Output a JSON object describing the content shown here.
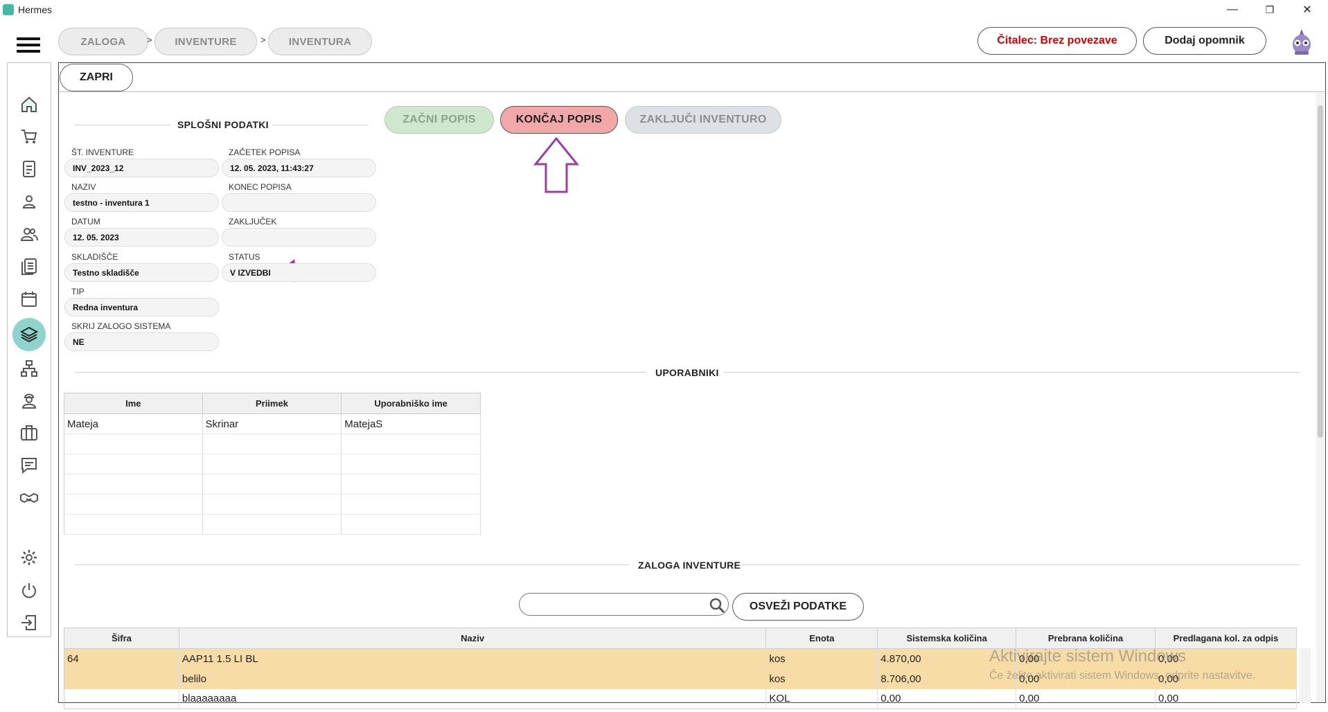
{
  "window": {
    "title": "Hermes",
    "minimize": "—",
    "maximize": "❐",
    "close": "✕"
  },
  "breadcrumb": [
    "ZALOGA",
    "INVENTURE",
    "INVENTURA"
  ],
  "breadcrumb_sep": ">",
  "header": {
    "reader_status": "Čitalec: Brez povezave",
    "reader_color": "#d00000",
    "add_reminder": "Dodaj opomnik"
  },
  "toolbar": {
    "close": "ZAPRI"
  },
  "actions": {
    "start": "ZAČNI POPIS",
    "start_color": "#cfe6cf",
    "finish": "KONČAJ POPIS",
    "finish_color": "#f2a7a9",
    "close_inventory": "ZAKLJUČI INVENTURO",
    "close_color": "#dde0e4"
  },
  "general": {
    "title": "SPLOŠNI PODATKI",
    "inv_no_label": "ŠT. INVENTURE",
    "inv_no": "INV_2023_12",
    "name_label": "NAZIV",
    "name": "testno - inventura 1",
    "date_label": "DATUM",
    "date": "12. 05. 2023",
    "warehouse_label": "SKLADIŠČE",
    "warehouse": "Testno skladišče",
    "type_label": "TIP",
    "type": "Redna inventura",
    "hide_label": "SKRIJ ZALOGO SISTEMA",
    "hide": "NE",
    "start_label": "ZAČETEK POPISA",
    "start": "12. 05. 2023, 11:43:27",
    "end_label": "KONEC POPISA",
    "end": "",
    "closing_label": "ZAKLJUČEK",
    "closing": "",
    "status_label": "STATUS",
    "status": "V IZVEDBI"
  },
  "users": {
    "title": "UPORABNIKI",
    "columns": [
      "Ime",
      "Priimek",
      "Uporabniško ime"
    ],
    "rows": [
      [
        "Mateja",
        "Skrinar",
        "MatejaS"
      ]
    ]
  },
  "stock": {
    "title": "ZALOGA INVENTURE",
    "search_placeholder": "",
    "refresh": "OSVEŽI PODATKE",
    "columns": [
      "Šifra",
      "Naziv",
      "Enota",
      "Sistemska količina",
      "Prebrana količina",
      "Predlagana kol. za odpis"
    ],
    "rows": [
      {
        "code": "64",
        "name": "AAP11 1.5 LI BL",
        "unit": "kos",
        "system": "4.870,00",
        "read": "0,00",
        "writeoff": "0,00",
        "highlight": true
      },
      {
        "code": "",
        "name": "belilo",
        "unit": "kos",
        "system": "8.706,00",
        "read": "0,00",
        "writeoff": "0,00",
        "highlight": true
      },
      {
        "code": "",
        "name": "blaaaaaaaa",
        "unit": "KOL",
        "system": "0,00",
        "read": "0,00",
        "writeoff": "0,00",
        "highlight": false
      }
    ]
  },
  "watermark": {
    "line1": "Aktivirajte sistem Windows",
    "line2": "Če želite aktivirati sistem Windows, odprite nastavitve."
  },
  "annotation_color": "#9b3fa3",
  "accent_teal": "#8ed3cc"
}
